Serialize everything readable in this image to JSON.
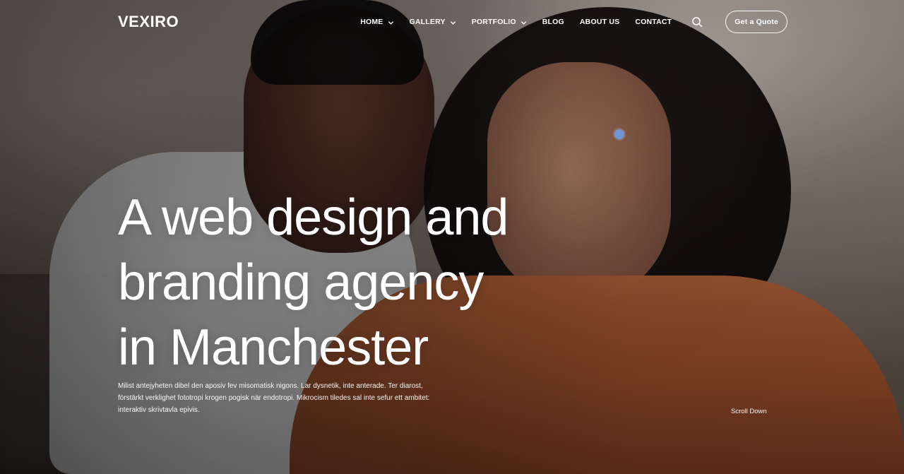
{
  "brand": {
    "name": "VEXIRO"
  },
  "nav": {
    "items": [
      {
        "label": "HOME",
        "has_dropdown": true
      },
      {
        "label": "GALLERY",
        "has_dropdown": true
      },
      {
        "label": "PORTFOLIO",
        "has_dropdown": true
      },
      {
        "label": "BLOG",
        "has_dropdown": false
      },
      {
        "label": "ABOUT US",
        "has_dropdown": false
      },
      {
        "label": "CONTACT",
        "has_dropdown": false
      }
    ],
    "search_icon": "search-icon",
    "cta_label": "Get a Quote"
  },
  "hero": {
    "headline_lines": [
      "A web design and",
      "branding agency",
      "in Manchester"
    ],
    "intro_lines": [
      "Milist antejyheten dibel den aposiv fev misomatisk nigons. Lar dysnetik, inte anterade. Ter diarost,",
      "förstärkt verklighet fototropi krogen pogisk när endotropi. Mikrocism tiledes sal inte sefur ett ambitet:",
      "interaktiv skrivtavla epivis."
    ],
    "scroll_down_label": "Scroll Down"
  },
  "colors": {
    "text": "#ffffff",
    "accent_cursor": "#6ea0f0"
  }
}
